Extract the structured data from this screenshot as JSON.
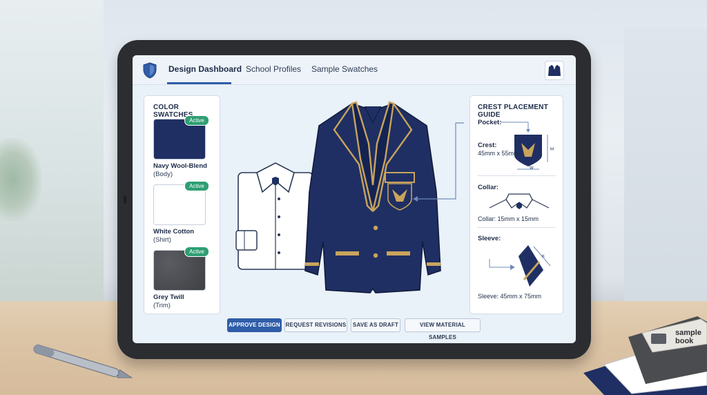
{
  "header": {
    "tabs": [
      {
        "label": "Design Dashboard",
        "active": true
      },
      {
        "label": "School Profiles",
        "active": false
      },
      {
        "label": "Sample Swatches",
        "active": false
      }
    ],
    "icons": {
      "logo": "shield-icon",
      "account": "blazer-icon"
    }
  },
  "swatches": {
    "title": "COLOR SWATCHES",
    "items": [
      {
        "name": "Navy Wool-Blend",
        "sub": "(Body)",
        "badge": "Active",
        "color": "#1f2f63"
      },
      {
        "name": "White Cotton",
        "sub": "(Shirt)",
        "badge": "Active",
        "color": "#ffffff"
      },
      {
        "name": "Grey Twill",
        "sub": "(Trim)",
        "badge": "Active",
        "color": "#4a4c50"
      }
    ]
  },
  "guide": {
    "title": "CREST PLACEMENT GUIDE",
    "pocket_label": "Pocket:",
    "crest_label": "Crest:",
    "crest_dims": "45mm x 55mm",
    "h_marker": "H",
    "w_marker": "W",
    "collar_label": "Collar:",
    "collar_dims": "Collar: 15mm x 15mm",
    "sleeve_label": "Sleeve:",
    "sleeve_dims": "Sleeve: 45mm x 75mm",
    "k_marker": "K"
  },
  "actions": {
    "approve": "APPROVE DESIGN",
    "revisions": "REQUEST REVISIONS",
    "draft": "SAVE AS DRAFT",
    "samples": "VIEW MATERIAL SAMPLES"
  },
  "desk_items": {
    "sample_book_line1": "sample",
    "sample_book_line2": "book"
  },
  "colors": {
    "navy": "#1f2f63",
    "gold": "#c9a45c",
    "accent": "#2f5da8",
    "active_badge": "#2e9e73"
  }
}
